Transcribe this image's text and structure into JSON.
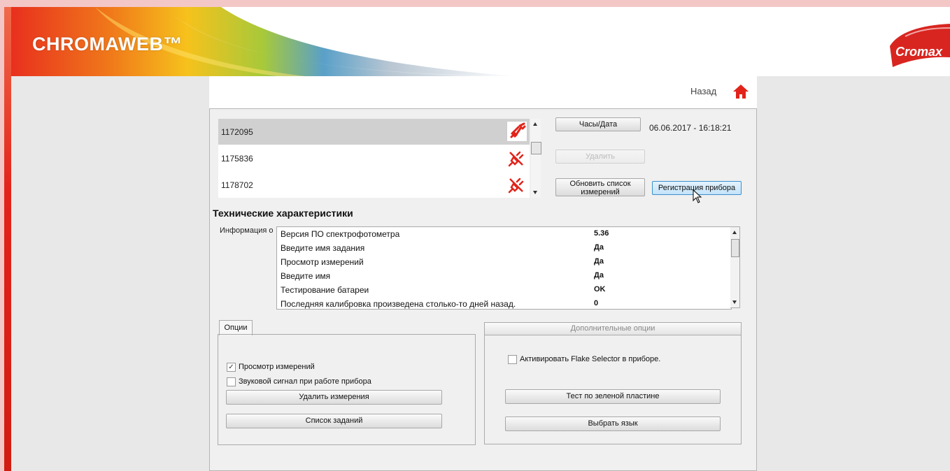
{
  "app": {
    "logo_text": "CHROMAWEB™",
    "brand_text": "Cromax"
  },
  "nav": {
    "back_label": "Назад"
  },
  "devices": [
    {
      "id": "1172095",
      "selected": true,
      "icon": "plug-connected-icon"
    },
    {
      "id": "1175836",
      "selected": false,
      "icon": "plug-disconnected-icon"
    },
    {
      "id": "1178702",
      "selected": false,
      "icon": "plug-disconnected-icon"
    }
  ],
  "controls": {
    "clock_button": "Часы/Дата",
    "datetime": "06.06.2017 - 16:18:21",
    "delete_button": "Удалить",
    "refresh_button": "Обновить список измерений",
    "register_button": "Регистрация прибора"
  },
  "specs": {
    "title": "Технические характеристики",
    "info_label": "Информация о",
    "rows": [
      {
        "key": "Версия ПО спектрофотометра",
        "value": "5.36"
      },
      {
        "key": "Введите имя задания",
        "value": "Да"
      },
      {
        "key": "Просмотр измерений",
        "value": "Да"
      },
      {
        "key": "Введите имя",
        "value": "Да"
      },
      {
        "key": "Тестирование батареи",
        "value": "OK"
      },
      {
        "key": "Последняя калибровка произведена столько-то дней назад.",
        "value": "0"
      }
    ]
  },
  "options": {
    "tab_label": "Опции",
    "view_measurements": {
      "label": "Просмотр измерений",
      "checked": true
    },
    "beep": {
      "label": "Звуковой сигнал при работе прибора",
      "checked": false
    },
    "delete_measurements_button": "Удалить измерения",
    "job_list_button": "Список заданий"
  },
  "extra": {
    "header": "Дополнительные опции",
    "flake_selector": {
      "label": "Активировать Flake Selector в приборе.",
      "checked": false
    },
    "green_tile_button": "Тест по зеленой пластине",
    "language_button": "Выбрать язык"
  },
  "colors": {
    "accent_red": "#e2231a",
    "highlight_blue": "#c4e3f9"
  }
}
